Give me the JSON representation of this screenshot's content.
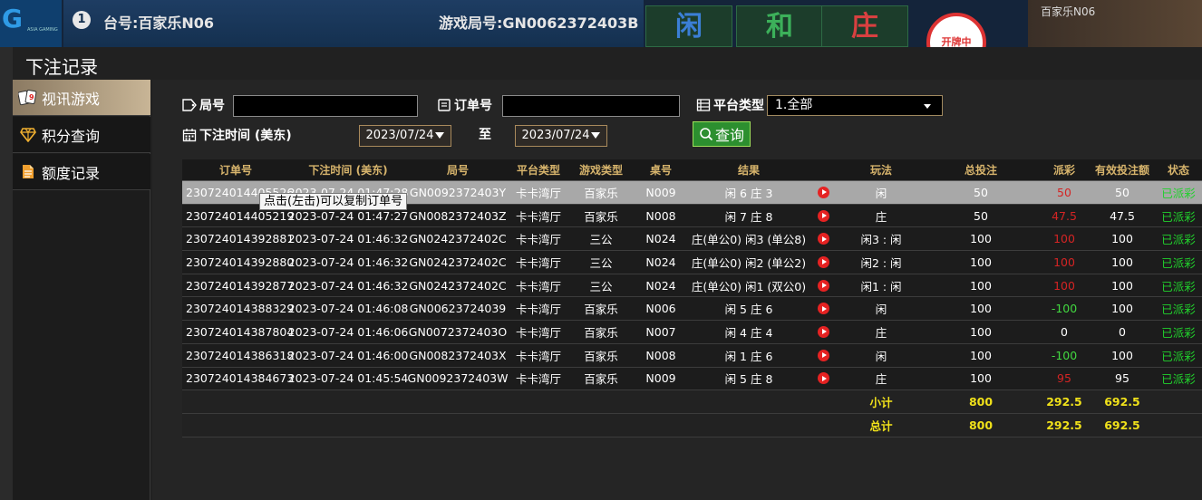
{
  "background": {
    "logo_letter": "G",
    "logo_sub": "ASIA GAMING",
    "table_number": "1",
    "table_label": "台号:百家乐N06",
    "round_label": "游戏局号:GN0062372403B",
    "bet_player": "闲",
    "bet_tie": "和",
    "bet_banker": "庄",
    "open_status": "开牌中",
    "video_label": "百家乐N06"
  },
  "modal": {
    "title": "下注记录"
  },
  "sidebar": {
    "items": [
      {
        "label": "视讯游戏",
        "icon": "playing-cards-icon",
        "active": true
      },
      {
        "label": "积分查询",
        "icon": "diamond-icon",
        "active": false
      },
      {
        "label": "额度记录",
        "icon": "document-icon",
        "active": false
      }
    ]
  },
  "filters": {
    "round_label": "局号",
    "round_value": "",
    "order_label": "订单号",
    "order_value": "",
    "platform_label": "平台类型",
    "platform_value": "1.全部",
    "time_label": "下注时间 (美东)",
    "date_from": "2023/07/24",
    "date_to_label": "至",
    "date_to": "2023/07/24",
    "query_label": "查询"
  },
  "table": {
    "headers": [
      "订单号",
      "下注时间 (美东)",
      "局号",
      "平台类型",
      "游戏类型",
      "桌号",
      "结果",
      "玩法",
      "总投注",
      "派彩",
      "有效投注额",
      "状态"
    ],
    "rows": [
      {
        "order": "230724014405526",
        "time": "2023-07-24 01:47:28",
        "round": "GN0092372403Y",
        "platform": "卡卡湾厅",
        "game": "百家乐",
        "table": "N009",
        "result": "闲 6 庄 3",
        "method": "闲",
        "total": "50",
        "payout": "50",
        "payout_type": "lose",
        "valid": "50",
        "status": "已派彩",
        "highlight": true
      },
      {
        "order": "230724014405219",
        "time": "2023-07-24 01:47:27",
        "round": "GN0082372403Z",
        "platform": "卡卡湾厅",
        "game": "百家乐",
        "table": "N008",
        "result": "闲 7 庄 8",
        "method": "庄",
        "total": "50",
        "payout": "47.5",
        "payout_type": "lose",
        "valid": "47.5",
        "status": "已派彩",
        "highlight": false
      },
      {
        "order": "230724014392881",
        "time": "2023-07-24 01:46:32",
        "round": "GN0242372402C",
        "platform": "卡卡湾厅",
        "game": "三公",
        "table": "N024",
        "result": "庄(单公0) 闲3 (单公8)",
        "method": "闲3 : 闲",
        "total": "100",
        "payout": "100",
        "payout_type": "lose",
        "valid": "100",
        "status": "已派彩",
        "highlight": false
      },
      {
        "order": "230724014392880",
        "time": "2023-07-24 01:46:32",
        "round": "GN0242372402C",
        "platform": "卡卡湾厅",
        "game": "三公",
        "table": "N024",
        "result": "庄(单公0) 闲2 (单公2)",
        "method": "闲2 : 闲",
        "total": "100",
        "payout": "100",
        "payout_type": "lose",
        "valid": "100",
        "status": "已派彩",
        "highlight": false
      },
      {
        "order": "230724014392877",
        "time": "2023-07-24 01:46:32",
        "round": "GN0242372402C",
        "platform": "卡卡湾厅",
        "game": "三公",
        "table": "N024",
        "result": "庄(单公0) 闲1 (双公0)",
        "method": "闲1 : 闲",
        "total": "100",
        "payout": "100",
        "payout_type": "lose",
        "valid": "100",
        "status": "已派彩",
        "highlight": false
      },
      {
        "order": "230724014388329",
        "time": "2023-07-24 01:46:08",
        "round": "GN00623724039",
        "platform": "卡卡湾厅",
        "game": "百家乐",
        "table": "N006",
        "result": "闲 5 庄 6",
        "method": "闲",
        "total": "100",
        "payout": "-100",
        "payout_type": "win",
        "valid": "100",
        "status": "已派彩",
        "highlight": false
      },
      {
        "order": "230724014387804",
        "time": "2023-07-24 01:46:06",
        "round": "GN0072372403O",
        "platform": "卡卡湾厅",
        "game": "百家乐",
        "table": "N007",
        "result": "闲 4 庄 4",
        "method": "庄",
        "total": "100",
        "payout": "0",
        "payout_type": "neutral",
        "valid": "0",
        "status": "已派彩",
        "highlight": false
      },
      {
        "order": "230724014386318",
        "time": "2023-07-24 01:46:00",
        "round": "GN0082372403X",
        "platform": "卡卡湾厅",
        "game": "百家乐",
        "table": "N008",
        "result": "闲 1 庄 6",
        "method": "闲",
        "total": "100",
        "payout": "-100",
        "payout_type": "win",
        "valid": "100",
        "status": "已派彩",
        "highlight": false
      },
      {
        "order": "230724014384673",
        "time": "2023-07-24 01:45:54",
        "round": "GN0092372403W",
        "platform": "卡卡湾厅",
        "game": "百家乐",
        "table": "N009",
        "result": "闲 5 庄 8",
        "method": "庄",
        "total": "100",
        "payout": "95",
        "payout_type": "lose",
        "valid": "95",
        "status": "已派彩",
        "highlight": false
      }
    ],
    "subtotal": {
      "label": "小计",
      "total": "800",
      "payout": "292.5",
      "valid": "692.5"
    },
    "grandtotal": {
      "label": "总计",
      "total": "800",
      "payout": "292.5",
      "valid": "692.5"
    }
  },
  "tooltip": {
    "text": "点击(左击)可以复制订单号"
  },
  "colors": {
    "accent_gold": "#d7b46c",
    "status_green": "#21d12c",
    "payout_green": "#42d940",
    "payout_red": "#d42424",
    "total_yellow": "#f0e11a",
    "query_green": "#2c8f2f"
  }
}
